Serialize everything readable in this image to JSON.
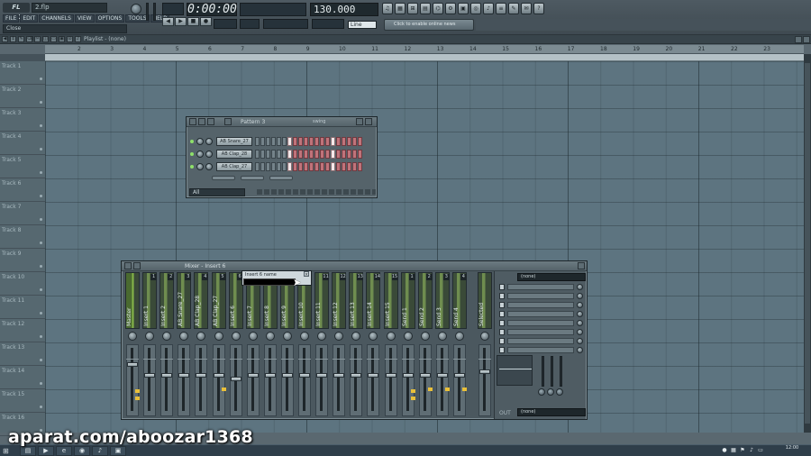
{
  "topbar": {
    "logo": "FL STUDIO",
    "file_name": "2.flp",
    "menu": [
      "FILE",
      "EDIT",
      "CHANNELS",
      "VIEW",
      "OPTIONS",
      "TOOLS",
      "HELP"
    ],
    "hint": "Close",
    "time": "0:00:00",
    "bpm": "130.000",
    "pattern_selector": "Line",
    "transport": [
      "◀",
      "▶",
      "■",
      "●"
    ],
    "toolbar_icons": [
      "♫",
      "▦",
      "⊞",
      "▤",
      "⌬",
      "⚙",
      "▣",
      "◎",
      "♪",
      "≡",
      "✎",
      "✉",
      "?"
    ],
    "news": "Click to enable online news"
  },
  "playlist": {
    "title": "Playlist - (none)",
    "tools": [
      "◀",
      "↕",
      "✎",
      "⌫",
      "✂",
      "◫",
      "▭",
      "▣",
      "⊙",
      "♪"
    ],
    "ruler": [
      "2",
      "3",
      "4",
      "5",
      "6",
      "7",
      "8",
      "9",
      "10",
      "11",
      "12",
      "13",
      "14",
      "15",
      "16",
      "17",
      "18",
      "19",
      "20",
      "21",
      "22",
      "23"
    ],
    "tracks": [
      "Track 1",
      "Track 2",
      "Track 3",
      "Track 4",
      "Track 5",
      "Track 6",
      "Track 7",
      "Track 8",
      "Track 9",
      "Track 10",
      "Track 11",
      "Track 12",
      "Track 13",
      "Track 14",
      "Track 15",
      "Track 16"
    ]
  },
  "stepseq": {
    "title": "Pattern 3",
    "swing_label": "swing",
    "channels": [
      {
        "name": "AB Snare_27"
      },
      {
        "name": "AB Clap_28"
      },
      {
        "name": "AB Clap_27"
      }
    ],
    "filter": "All"
  },
  "mixer": {
    "title": "Mixer - Insert 6",
    "strips": [
      {
        "num": "",
        "label": "Master"
      },
      {
        "num": "1",
        "label": "Insert 1"
      },
      {
        "num": "2",
        "label": "Insert 2"
      },
      {
        "num": "3",
        "label": "AB Snare_27"
      },
      {
        "num": "4",
        "label": "AB Clap_28"
      },
      {
        "num": "5",
        "label": "AB Clap_27"
      },
      {
        "num": "6",
        "label": "Insert 6"
      },
      {
        "num": "7",
        "label": "Insert 7"
      },
      {
        "num": "8",
        "label": "Insert 8"
      },
      {
        "num": "9",
        "label": "Insert 9"
      },
      {
        "num": "10",
        "label": "Insert 10"
      },
      {
        "num": "11",
        "label": "Insert 11"
      },
      {
        "num": "12",
        "label": "Insert 12"
      },
      {
        "num": "13",
        "label": "Insert 13"
      },
      {
        "num": "14",
        "label": "Insert 14"
      },
      {
        "num": "15",
        "label": "Insert 15"
      },
      {
        "num": "1",
        "label": "Send 1"
      },
      {
        "num": "2",
        "label": "Send 2"
      },
      {
        "num": "3",
        "label": "Send 3"
      },
      {
        "num": "4",
        "label": "Send 4"
      },
      {
        "num": "",
        "label": "Selected"
      }
    ],
    "rename_title": "Insert 6 name",
    "fx_in": "(none)",
    "fx_out": "(none)",
    "out_label": "OUT"
  },
  "watermark": "aparat.com/aboozar1368",
  "taskbar": {
    "time": "12:00"
  }
}
